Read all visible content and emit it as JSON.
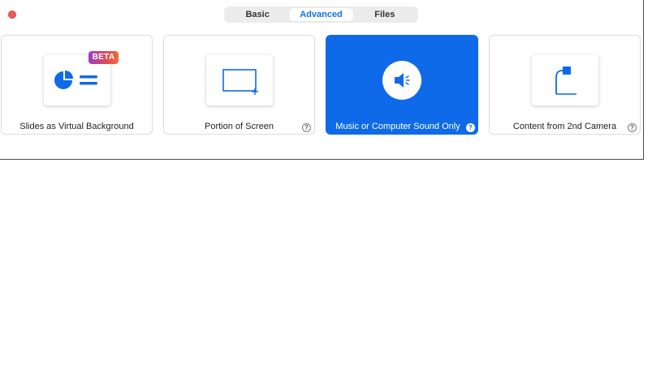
{
  "window": {
    "tabs": [
      {
        "label": "Basic",
        "active": false
      },
      {
        "label": "Advanced",
        "active": true
      },
      {
        "label": "Files",
        "active": false
      }
    ]
  },
  "options": [
    {
      "label": "Slides as Virtual Background",
      "icon": "slides-icon",
      "badge": "BETA",
      "selected": false,
      "help": false
    },
    {
      "label": "Portion of Screen",
      "icon": "portion-screen-icon",
      "selected": false,
      "help": true
    },
    {
      "label": "Music or Computer Sound Only",
      "icon": "speaker-icon",
      "selected": true,
      "help": true
    },
    {
      "label": "Content from 2nd Camera",
      "icon": "camera-icon",
      "selected": false,
      "help": true
    }
  ],
  "help_glyph": "?",
  "colors": {
    "accent": "#0e6ae8",
    "close": "#ee5b55",
    "badge_start": "#9c3ec8",
    "badge_end": "#f06a3a"
  }
}
